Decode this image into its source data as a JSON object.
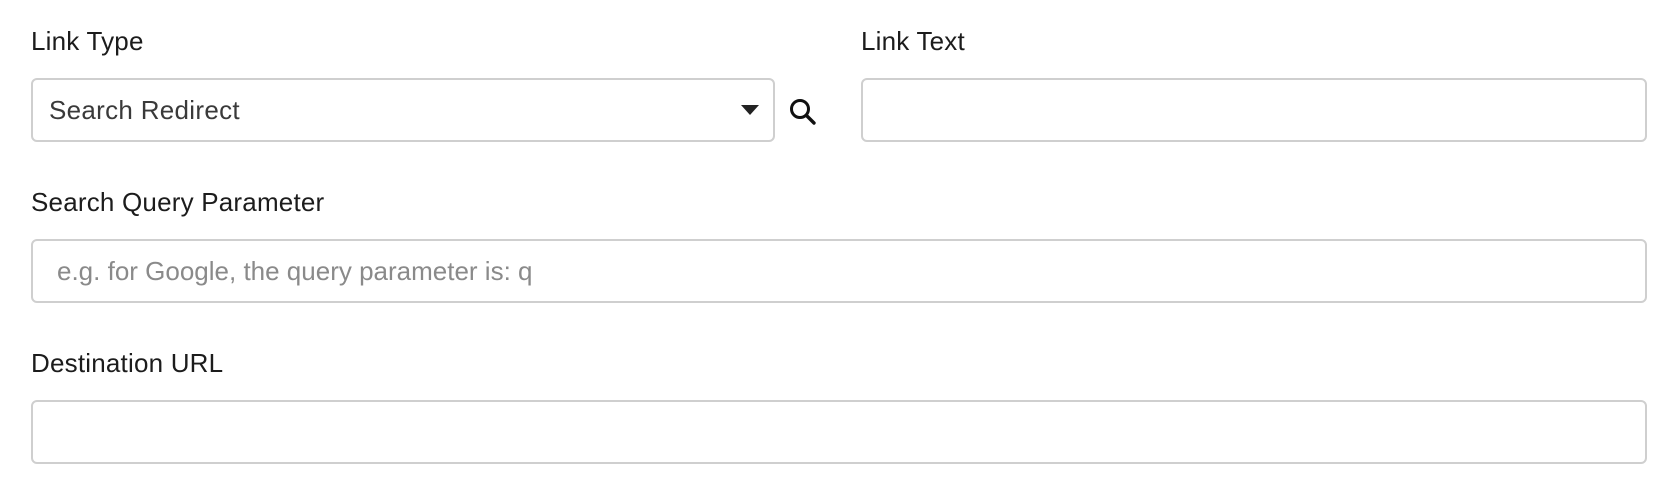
{
  "link_type": {
    "label": "Link Type",
    "selected": "Search Redirect"
  },
  "link_text": {
    "label": "Link Text",
    "value": ""
  },
  "search_query_parameter": {
    "label": "Search Query Parameter",
    "value": "",
    "placeholder": "e.g. for Google, the query parameter is: q"
  },
  "destination_url": {
    "label": "Destination URL",
    "value": ""
  },
  "icons": {
    "select_caret": "chevron-down-icon",
    "search": "search-icon"
  },
  "colors": {
    "border": "#cfcfcf",
    "label_text": "#1c1c1c",
    "placeholder_text": "#8a8a8a"
  }
}
